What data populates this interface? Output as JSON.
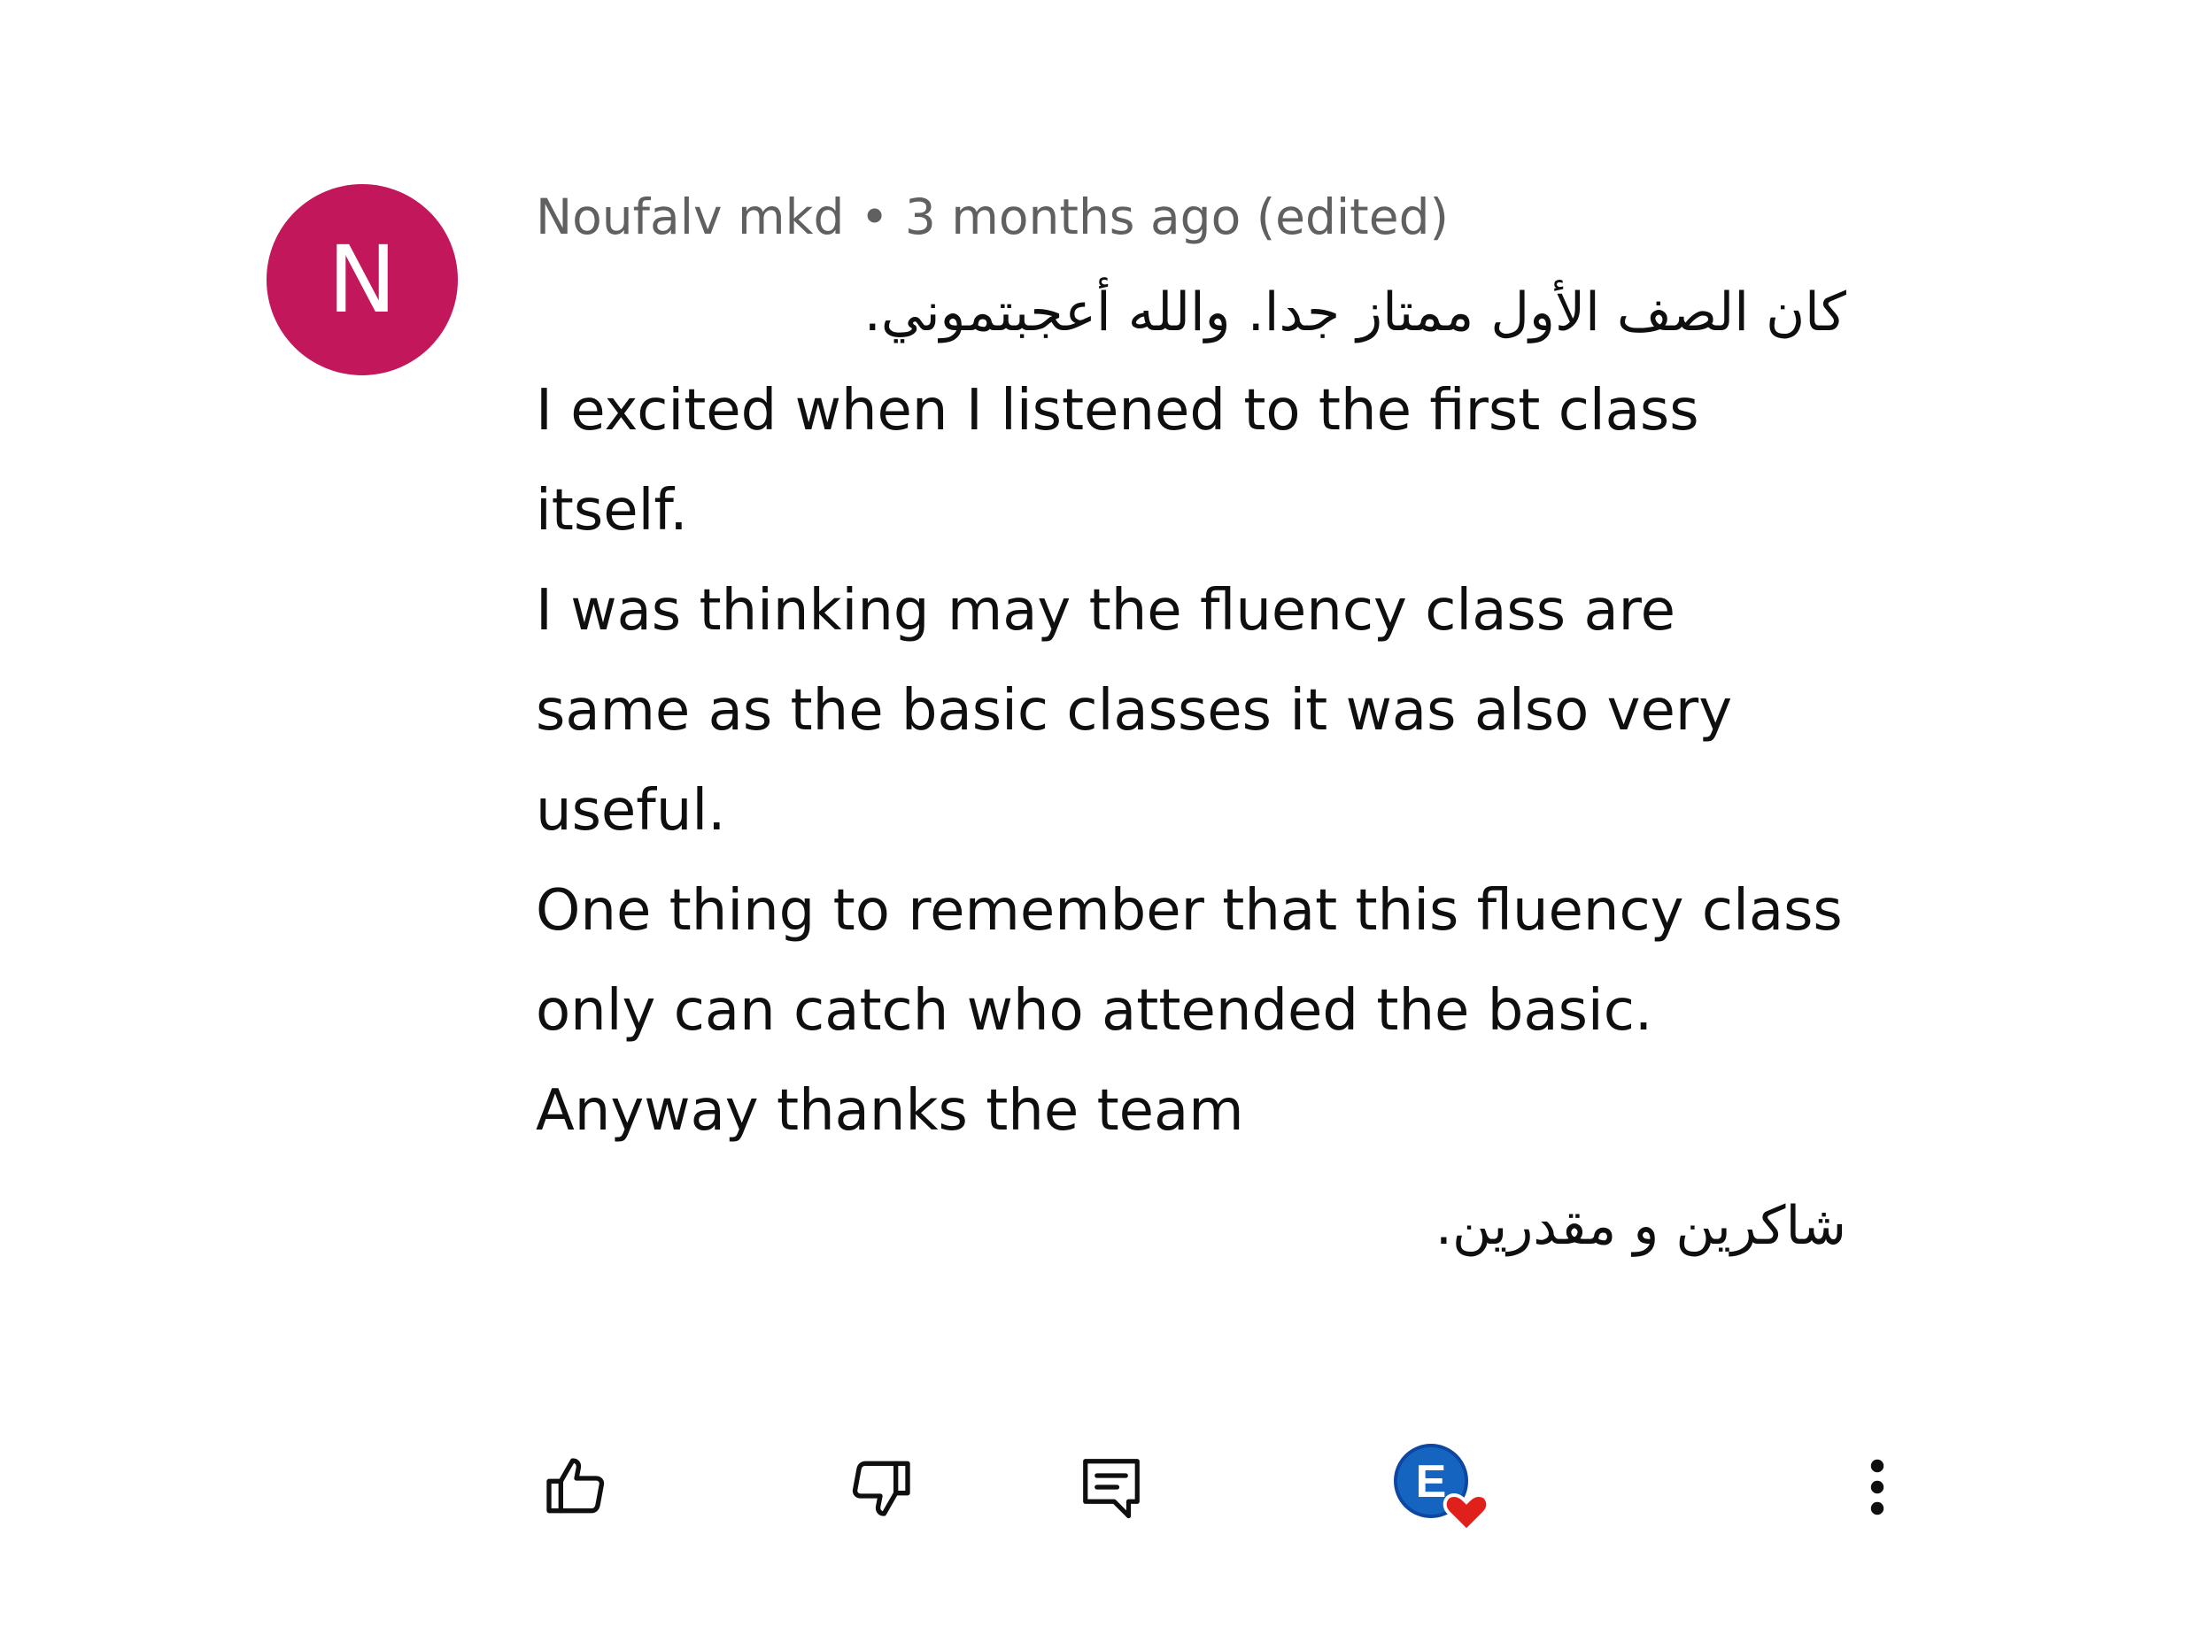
{
  "comment": {
    "avatar_letter": "N",
    "avatar_color": "#c2185b",
    "author": "Noufalv mkd",
    "separator": "•",
    "timestamp": "3 months ago (edited)",
    "arabic_line_1": "كان الصف الأول ممتاز جدا. والله أعجبتموني.",
    "paragraphs": [
      "I excited when I listened to the first class itself.",
      "I was thinking may the fluency class are same as the basic classes it was also  very useful.",
      "One thing to remember that this fluency class only can catch who attended the basic.",
      "Anyway thanks the team"
    ],
    "arabic_line_2": "شاكرين و مقدرين."
  },
  "actions": {
    "like_icon": "thumbs-up-icon",
    "dislike_icon": "thumbs-down-icon",
    "reply_icon": "reply-comment-icon",
    "heart_icon": "creator-heart-icon",
    "heart_color": "#e0201b",
    "creator_avatar_color": "#1565c0",
    "more_icon": "more-vertical-icon"
  }
}
